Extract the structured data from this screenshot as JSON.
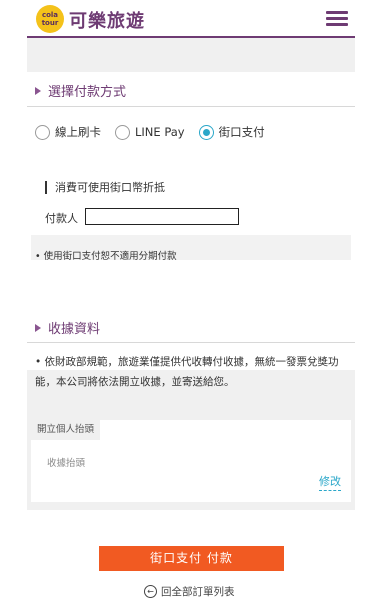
{
  "header": {
    "logo_line1": "cola",
    "logo_line2": "tour",
    "brand": "可樂旅遊",
    "menu_icon": "hamburger-menu-icon"
  },
  "payment_section": {
    "title": "選擇付款方式",
    "options": [
      {
        "label": "線上刷卡",
        "selected": false
      },
      {
        "label": "LINE Pay",
        "selected": false
      },
      {
        "label": "街口支付",
        "selected": true
      }
    ],
    "box_title": "消費可使用街口幣折抵",
    "payer_label": "付款人",
    "payer_value": "",
    "note": "• 使用街口支付恕不適用分期付款"
  },
  "receipt_section": {
    "title": "收據資料",
    "description": "• 依財政部規範，旅遊業僅提供代收轉付收據，無統一發票兌獎功能，本公司將依法開立收據，並寄送給您。",
    "tab_label": "開立個人抬頭",
    "hint": "收據抬頭",
    "edit_label": "修改"
  },
  "actions": {
    "pay_button": "街口支付 付款",
    "back_label": "回全部訂單列表",
    "back_icon": "back-arrow-circle-icon"
  },
  "colors": {
    "brand_purple": "#6e3b73",
    "accent_blue": "#2aa7c9",
    "pay_orange": "#f15a22",
    "logo_yellow": "#f4c21a"
  }
}
